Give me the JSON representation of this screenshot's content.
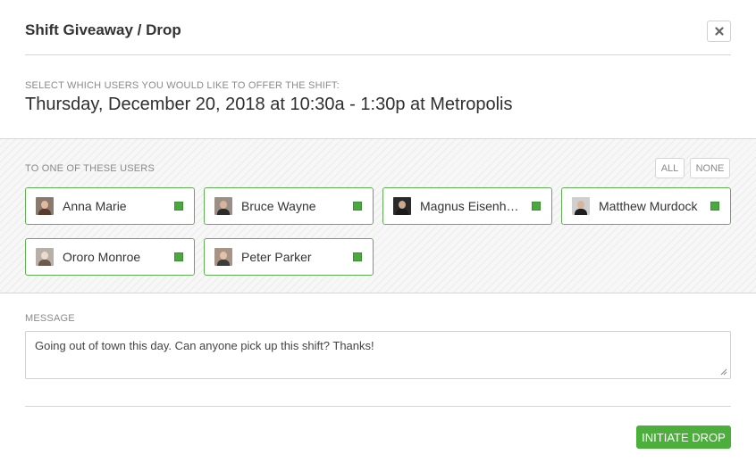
{
  "modal": {
    "title": "Shift Giveaway / Drop"
  },
  "shift": {
    "instruction": "SELECT WHICH USERS YOU WOULD LIKE TO OFFER THE SHIFT:",
    "description": "Thursday, December 20, 2018 at 10:30a - 1:30p at Metropolis"
  },
  "users": {
    "label": "TO ONE OF THESE USERS",
    "all_label": "ALL",
    "none_label": "NONE",
    "list": [
      {
        "name": "Anna Marie",
        "selected": true,
        "avatar_colors": {
          "bg": "#8a7a6e",
          "face": "#e0b9a0",
          "body": "#5a3c2e"
        }
      },
      {
        "name": "Bruce Wayne",
        "selected": true,
        "avatar_colors": {
          "bg": "#9b8f86",
          "face": "#d8b49c",
          "body": "#2b2b2b"
        }
      },
      {
        "name": "Magnus Eisenha…",
        "selected": true,
        "avatar_colors": {
          "bg": "#2a2a2a",
          "face": "#c9a88e",
          "body": "#1a1a1a"
        }
      },
      {
        "name": "Matthew Murdock",
        "selected": true,
        "avatar_colors": {
          "bg": "#cfcfcf",
          "face": "#d9b39a",
          "body": "#1f1f1f"
        }
      },
      {
        "name": "Ororo Monroe",
        "selected": true,
        "avatar_colors": {
          "bg": "#b8b0a6",
          "face": "#e8dccf",
          "body": "#6c5a4a"
        }
      },
      {
        "name": "Peter Parker",
        "selected": true,
        "avatar_colors": {
          "bg": "#a89484",
          "face": "#e2c2a8",
          "body": "#3c3c3c"
        }
      }
    ]
  },
  "message": {
    "label": "MESSAGE",
    "value": "Going out of town this day. Can anyone pick up this shift? Thanks!"
  },
  "actions": {
    "initiate_label": "INITIATE DROP"
  },
  "colors": {
    "accent": "#4caf3c",
    "card_border": "#5fb053"
  }
}
